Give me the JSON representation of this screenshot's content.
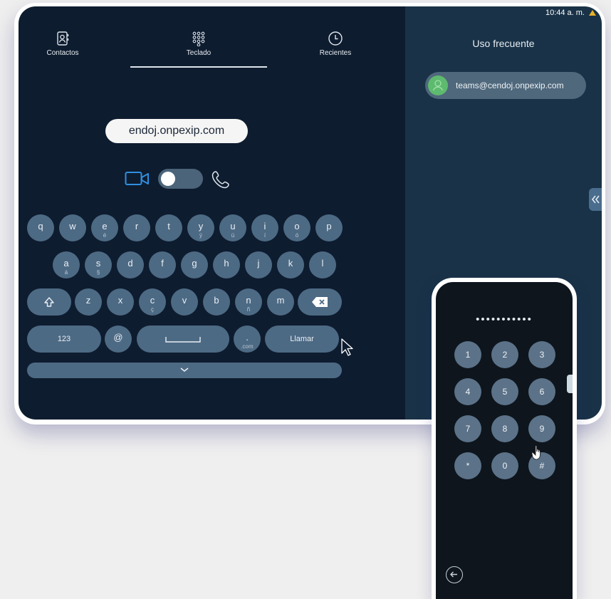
{
  "status": {
    "time": "10:44 a. m."
  },
  "nav": {
    "contacts": "Contactos",
    "keypad": "Teclado",
    "recents": "Recientes"
  },
  "dial": {
    "address": "endoj.onpexip.com"
  },
  "keyboard": {
    "row1": [
      {
        "k": "q",
        "s": ""
      },
      {
        "k": "w",
        "s": ""
      },
      {
        "k": "e",
        "s": "é"
      },
      {
        "k": "r",
        "s": ""
      },
      {
        "k": "t",
        "s": ""
      },
      {
        "k": "y",
        "s": "ý"
      },
      {
        "k": "u",
        "s": "ú"
      },
      {
        "k": "i",
        "s": "í"
      },
      {
        "k": "o",
        "s": "ó"
      },
      {
        "k": "p",
        "s": ""
      }
    ],
    "row2": [
      {
        "k": "a",
        "s": "á"
      },
      {
        "k": "s",
        "s": "§"
      },
      {
        "k": "d",
        "s": ""
      },
      {
        "k": "f",
        "s": ""
      },
      {
        "k": "g",
        "s": ""
      },
      {
        "k": "h",
        "s": ""
      },
      {
        "k": "j",
        "s": ""
      },
      {
        "k": "k",
        "s": ""
      },
      {
        "k": "l",
        "s": ""
      }
    ],
    "row3": [
      {
        "k": "z",
        "s": ""
      },
      {
        "k": "x",
        "s": ""
      },
      {
        "k": "c",
        "s": "ç"
      },
      {
        "k": "v",
        "s": ""
      },
      {
        "k": "b",
        "s": ""
      },
      {
        "k": "n",
        "s": "ñ"
      },
      {
        "k": "m",
        "s": ""
      }
    ],
    "numbers_label": "123",
    "at_label": "@",
    "dot_label": ".",
    "dot_sub": ".com",
    "call_label": "Llamar"
  },
  "frequent": {
    "title": "Uso frecuente",
    "items": [
      {
        "label": "teams@cendoj.onpexip.com"
      }
    ]
  },
  "phone": {
    "pin_mask": "•••••••••••",
    "keys": [
      "1",
      "2",
      "3",
      "4",
      "5",
      "6",
      "7",
      "8",
      "9",
      "*",
      "0",
      "#"
    ]
  },
  "colors": {
    "panel_left": "#0e1c2f",
    "panel_right": "#193247",
    "key": "#4d6a84",
    "accent_video": "#2f8fe0",
    "avatar_green": "#5eba6e"
  }
}
